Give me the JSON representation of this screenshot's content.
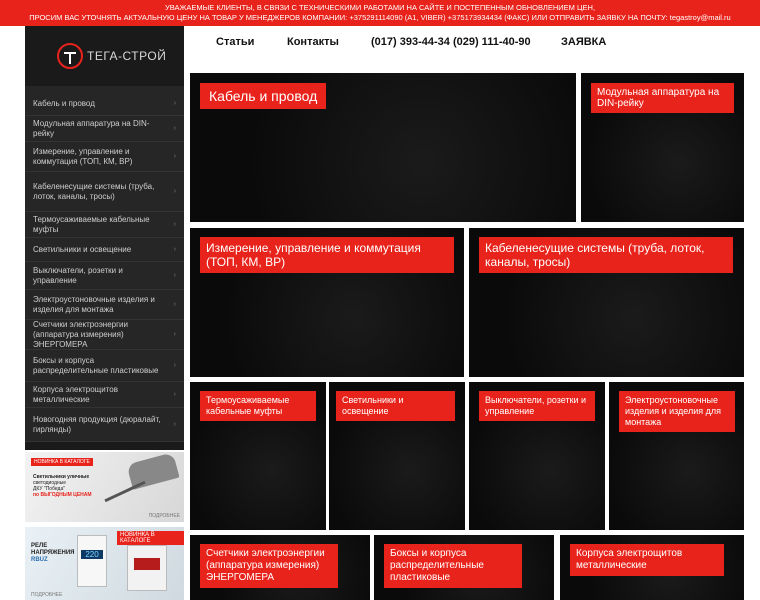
{
  "banner": {
    "line1": "УВАЖАЕМЫЕ КЛИЕНТЫ, В СВЯЗИ С ТЕХНИЧЕСКИМИ РАБОТАМИ НА САЙТЕ И ПОСТЕПЕННЫМ ОБНОВЛЕНИЕМ ЦЕН,",
    "line2": "ПРОСИМ ВАС УТОЧНЯТЬ АКТУАЛЬНУЮ ЦЕНУ НА ТОВАР У МЕНЕДЖЕРОВ КОМПАНИИ: +375291114090 (А1, VIBER) +375173934434 (ФАКС) ИЛИ ОТПРАВИТЬ ЗАЯВКУ НА ПОЧТУ: tegastroy@mail.ru"
  },
  "logo": {
    "text": "ТЕГА-СТРОЙ"
  },
  "nav": {
    "articles": "Статьи",
    "contacts": "Контакты",
    "phones": "(017) 393-44-34 (029) 111-40-90",
    "order": "ЗАЯВКА"
  },
  "sidebar": {
    "items": [
      {
        "label": "Кабель и провод"
      },
      {
        "label": "Модульная аппаратура на DIN-рейку"
      },
      {
        "label": "Измерение, управление и коммутация (ТОП, КМ, ВР)"
      },
      {
        "label": "Кабеленесущие системы (труба, лоток, каналы, тросы)"
      },
      {
        "label": "Термоусаживаемые кабельные муфты"
      },
      {
        "label": "Светильники и освещение"
      },
      {
        "label": "Выключатели, розетки и управление"
      },
      {
        "label": "Электроустоновочные изделия и изделия для монтажа"
      },
      {
        "label": "Счетчики электроэнергии (аппаратура измерения) ЭНЕРГОМЕРА"
      },
      {
        "label": "Боксы и корпуса распределительные пластиковые"
      },
      {
        "label": "Корпуса электрощитов металлические"
      },
      {
        "label": "Новогодняя продукция (дюралайт, гирлянды)"
      }
    ]
  },
  "promo1": {
    "badge": "НОВИНКА В КАТАЛОГЕ",
    "line1": "Светильники уличные",
    "line2": "светодиодные",
    "line3": "ДКУ \"Победа\"",
    "line4": "по ВЫГОДНЫМ ЦЕНАМ",
    "more": "ПОДРОБНЕЕ"
  },
  "promo2": {
    "badge": "НОВИНКА В КАТАЛОГЕ",
    "line1": "РЕЛЕ",
    "line2": "НАПРЯЖЕНИЯ",
    "line3": "RBUZ",
    "display": "220",
    "more": "ПОДРОБНЕЕ"
  },
  "tiles": [
    {
      "label": "Кабель и провод"
    },
    {
      "label": "Модульная аппаратура на DIN-рейку"
    },
    {
      "label": "Измерение, управление и коммутация (ТОП, КМ, ВР)"
    },
    {
      "label": "Кабеленесущие системы (труба, лоток, каналы, тросы)"
    },
    {
      "label": "Термоусаживаемые кабельные муфты"
    },
    {
      "label": "Светильники и освещение"
    },
    {
      "label": "Выключатели, розетки и управление"
    },
    {
      "label": "Электроустоновочные изделия и изделия для монтажа"
    },
    {
      "label": "Счетчики электроэнергии (аппаратура измерения) ЭНЕРГОМЕРА"
    },
    {
      "label": "Боксы и корпуса распределительные пластиковые"
    },
    {
      "label": "Корпуса электрощитов металлические"
    }
  ],
  "colors": {
    "accent": "#e8231b",
    "dark": "#0a0a0a",
    "sidebar": "#262626"
  }
}
